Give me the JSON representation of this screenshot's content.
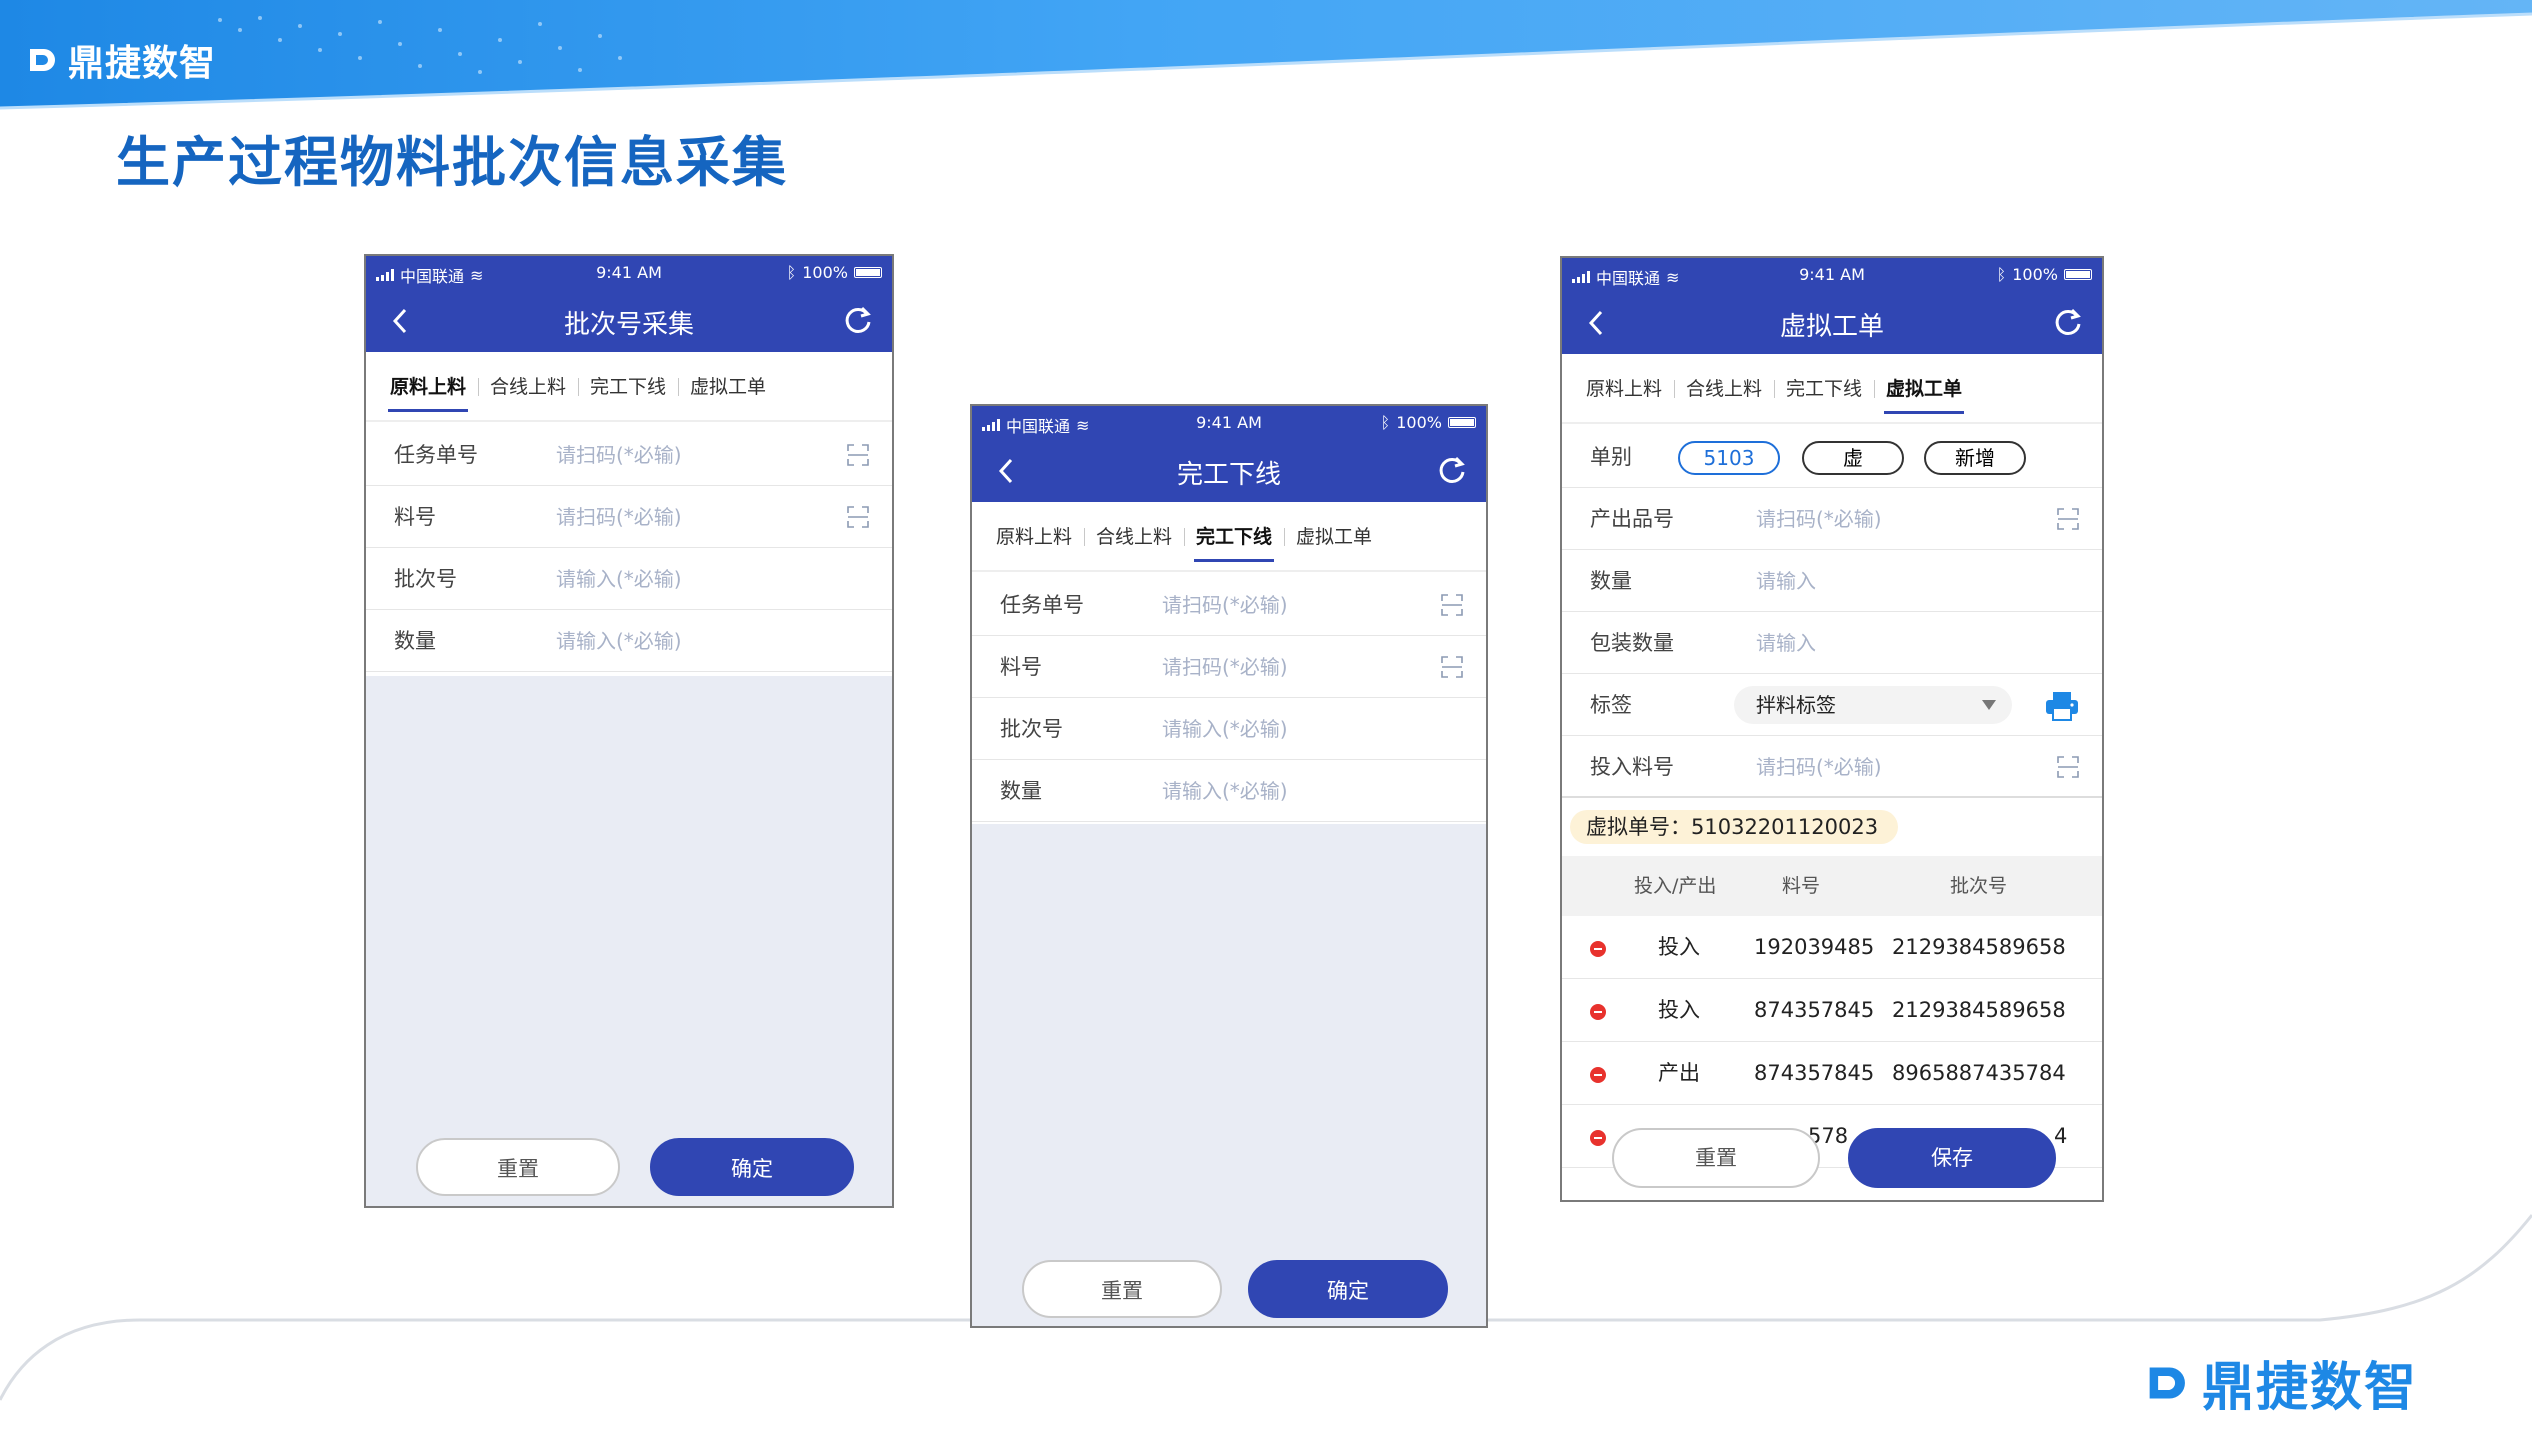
{
  "brand": {
    "name": "鼎捷数智"
  },
  "slide": {
    "title": "生产过程物料批次信息采集"
  },
  "status": {
    "carrier": "中国联通",
    "time": "9:41 AM",
    "battery": "100%"
  },
  "tabs": [
    "原料上料",
    "合线上料",
    "完工下线",
    "虚拟工单"
  ],
  "phone1": {
    "title": "批次号采集",
    "active_tab": 0,
    "fields": [
      {
        "label": "任务单号",
        "placeholder": "请扫码(*必输)"
      },
      {
        "label": "料号",
        "placeholder": "请扫码(*必输)"
      },
      {
        "label": "批次号",
        "placeholder": "请输入(*必输)"
      },
      {
        "label": "数量",
        "placeholder": "请输入(*必输)"
      }
    ],
    "reset": "重置",
    "confirm": "确定"
  },
  "phone2": {
    "title": "完工下线",
    "active_tab": 2,
    "fields": [
      {
        "label": "任务单号",
        "placeholder": "请扫码(*必输)"
      },
      {
        "label": "料号",
        "placeholder": "请扫码(*必输)"
      },
      {
        "label": "批次号",
        "placeholder": "请输入(*必输)"
      },
      {
        "label": "数量",
        "placeholder": "请输入(*必输)"
      }
    ],
    "reset": "重置",
    "confirm": "确定"
  },
  "phone3": {
    "title": "虚拟工单",
    "active_tab": 3,
    "type_label": "单别",
    "chips": [
      "5103",
      "虚",
      "新增"
    ],
    "fields": {
      "product": {
        "label": "产出品号",
        "placeholder": "请扫码(*必输)"
      },
      "quantity": {
        "label": "数量",
        "placeholder": "请输入"
      },
      "package_qty": {
        "label": "包装数量",
        "placeholder": "请输入"
      },
      "tag": {
        "label": "标签",
        "value": "拌料标签"
      },
      "input_part": {
        "label": "投入料号",
        "placeholder": "请扫码(*必输)"
      }
    },
    "virtual_no": "虚拟单号：51032201120023",
    "table_headers": [
      "投入/产出",
      "料号",
      "批次号"
    ],
    "rows": [
      {
        "type": "投入",
        "part": "192039485",
        "batch": "2129384589658"
      },
      {
        "type": "投入",
        "part": "874357845",
        "batch": "2129384589658"
      },
      {
        "type": "产出",
        "part": "874357845",
        "batch": "8965887435784"
      },
      {
        "type": "",
        "part": "578",
        "batch": "4"
      }
    ],
    "reset": "重置",
    "save": "保存"
  }
}
